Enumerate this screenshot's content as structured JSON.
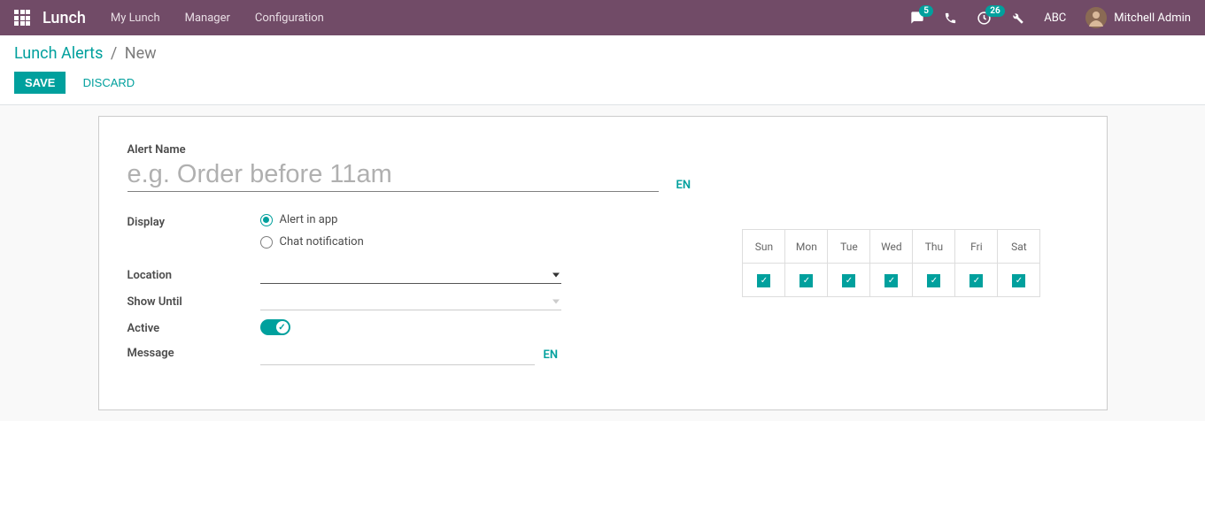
{
  "navbar": {
    "brand": "Lunch",
    "menu": [
      "My Lunch",
      "Manager",
      "Configuration"
    ],
    "chat_badge": "5",
    "clock_badge": "26",
    "company": "ABC",
    "user_name": "Mitchell Admin"
  },
  "breadcrumb": {
    "root": "Lunch Alerts",
    "current": "New"
  },
  "buttons": {
    "save": "Save",
    "discard": "Discard"
  },
  "form": {
    "alert_name_label": "Alert Name",
    "alert_name_placeholder": "e.g. Order before 11am",
    "alert_name_value": "",
    "lang_code": "EN",
    "display_label": "Display",
    "radio_alert": "Alert in app",
    "radio_chat": "Chat notification",
    "location_label": "Location",
    "location_value": "",
    "show_until_label": "Show Until",
    "show_until_value": "",
    "active_label": "Active",
    "active_on": true,
    "message_label": "Message",
    "message_value": "",
    "days": [
      "Sun",
      "Mon",
      "Tue",
      "Wed",
      "Thu",
      "Fri",
      "Sat"
    ],
    "days_checked": [
      true,
      true,
      true,
      true,
      true,
      true,
      true
    ]
  }
}
